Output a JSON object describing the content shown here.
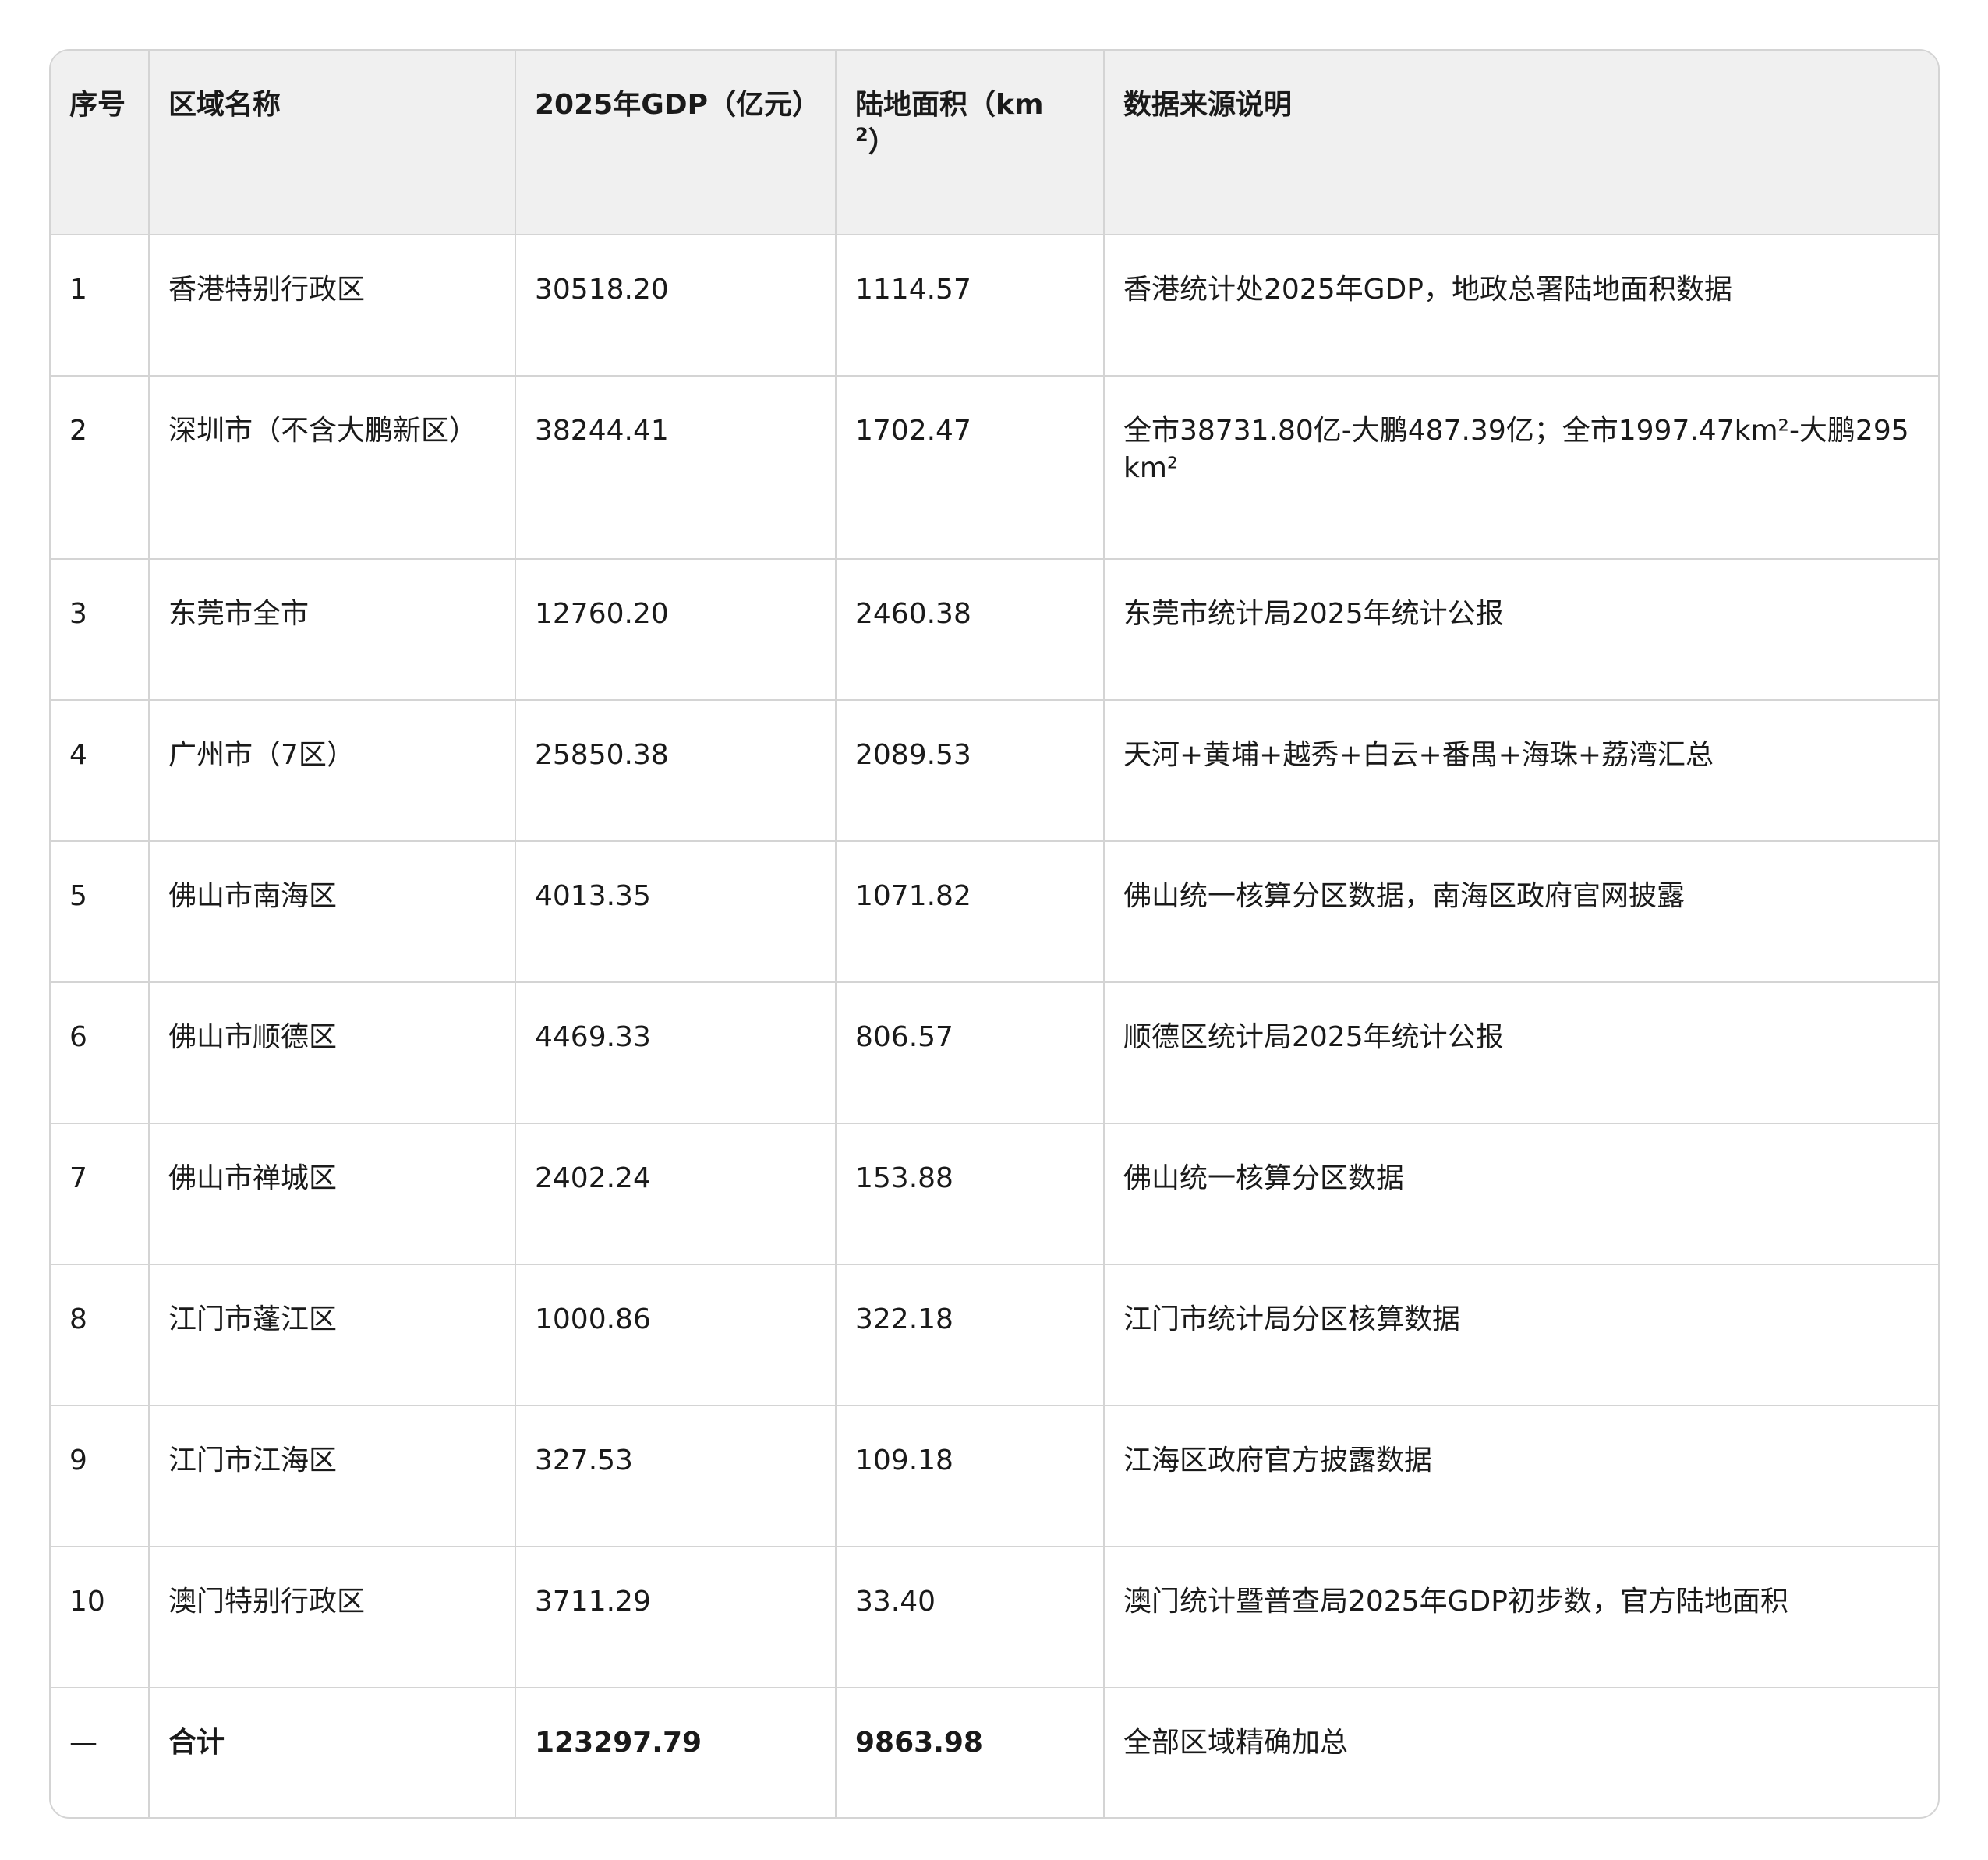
{
  "table": {
    "headers": {
      "index": "序号",
      "region": "区域名称",
      "gdp": "2025年GDP（亿元）",
      "area_prefix": "陆地面积（km",
      "area_sup": "2",
      "area_suffix": "）",
      "source": "数据来源说明"
    },
    "rows": [
      {
        "index": "1",
        "region": "香港特别行政区",
        "gdp": "30518.20",
        "area": "1114.57",
        "source": "香港统计处2025年GDP，地政总署陆地面积数据"
      },
      {
        "index": "2",
        "region": "深圳市（不含大鹏新区）",
        "gdp": "38244.41",
        "area": "1702.47",
        "source": "全市38731.80亿-大鹏487.39亿；全市1997.47km²-大鹏295km²"
      },
      {
        "index": "3",
        "region": "东莞市全市",
        "gdp": "12760.20",
        "area": "2460.38",
        "source": "东莞市统计局2025年统计公报"
      },
      {
        "index": "4",
        "region": "广州市（7区）",
        "gdp": "25850.38",
        "area": "2089.53",
        "source": "天河+黄埔+越秀+白云+番禺+海珠+荔湾汇总"
      },
      {
        "index": "5",
        "region": "佛山市南海区",
        "gdp": "4013.35",
        "area": "1071.82",
        "source": "佛山统一核算分区数据，南海区政府官网披露"
      },
      {
        "index": "6",
        "region": "佛山市顺德区",
        "gdp": "4469.33",
        "area": "806.57",
        "source": "顺德区统计局2025年统计公报"
      },
      {
        "index": "7",
        "region": "佛山市禅城区",
        "gdp": "2402.24",
        "area": "153.88",
        "source": "佛山统一核算分区数据"
      },
      {
        "index": "8",
        "region": "江门市蓬江区",
        "gdp": "1000.86",
        "area": "322.18",
        "source": "江门市统计局分区核算数据"
      },
      {
        "index": "9",
        "region": "江门市江海区",
        "gdp": "327.53",
        "area": "109.18",
        "source": "江海区政府官方披露数据"
      },
      {
        "index": "10",
        "region": "澳门特别行政区",
        "gdp": "3711.29",
        "area": "33.40",
        "source": "澳门统计暨普查局2025年GDP初步数，官方陆地面积"
      }
    ],
    "total": {
      "index": "—",
      "region": "合计",
      "gdp": "123297.79",
      "area": "9863.98",
      "source": "全部区域精确加总"
    }
  }
}
